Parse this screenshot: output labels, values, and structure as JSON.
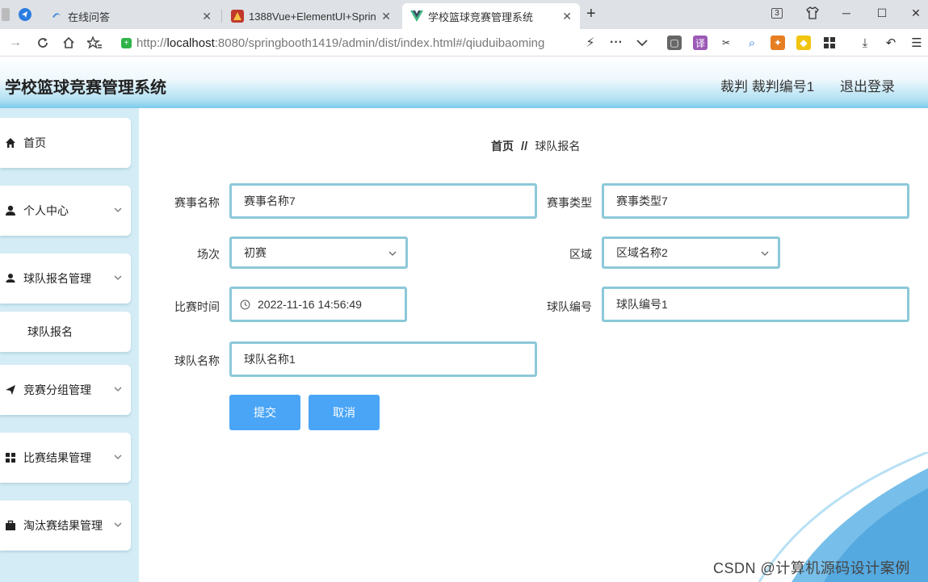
{
  "browser": {
    "tabs": [
      {
        "label": "在线问答"
      },
      {
        "label": "1388Vue+ElementUI+Sprin"
      },
      {
        "label": "学校篮球竞赛管理系统"
      }
    ],
    "tab_count_badge": "3",
    "url": "http://localhost:8080/springbooth1419/admin/dist/index.html#/qiuduibaoming",
    "url_host": "localhost",
    "url_rest": ":8080/springbooth1419/admin/dist/index.html#/qiuduibaoming"
  },
  "header": {
    "title": "学校篮球竞赛管理系统",
    "user": "裁判 裁判编号1",
    "logout": "退出登录"
  },
  "sidebar": {
    "items": [
      {
        "label": "首页",
        "icon": "home-icon"
      },
      {
        "label": "个人中心",
        "icon": "user-icon"
      },
      {
        "label": "球队报名管理",
        "icon": "user-icon"
      },
      {
        "label": "竞赛分组管理",
        "icon": "send-icon"
      },
      {
        "label": "比赛结果管理",
        "icon": "grid-icon"
      },
      {
        "label": "淘汰赛结果管理",
        "icon": "briefcase-icon"
      }
    ],
    "subitem": "球队报名"
  },
  "breadcrumb": {
    "home": "首页",
    "separator": "//",
    "current": "球队报名"
  },
  "form": {
    "event_name": {
      "label": "赛事名称",
      "value": "赛事名称7"
    },
    "event_type": {
      "label": "赛事类型",
      "value": "赛事类型7"
    },
    "round": {
      "label": "场次",
      "value": "初赛"
    },
    "region": {
      "label": "区域",
      "value": "区域名称2"
    },
    "match_time": {
      "label": "比赛时间",
      "value": "2022-11-16 14:56:49"
    },
    "team_no": {
      "label": "球队编号",
      "value": "球队编号1"
    },
    "team_name": {
      "label": "球队名称",
      "value": "球队名称1"
    },
    "submit": "提交",
    "cancel": "取消"
  },
  "watermark": "CSDN @计算机源码设计案例",
  "colors": {
    "accent": "#4aa5f7",
    "input_border": "#8cc8d8",
    "sidebar_bg": "#d4ecf5",
    "header_gradient_end": "#7ccbea"
  }
}
